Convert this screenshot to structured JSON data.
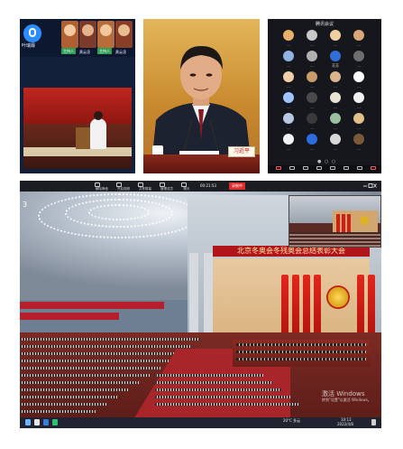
{
  "panel_phone": {
    "user_label": "叶瑞霖",
    "tile_tags": [
      "主持人",
      "主持人"
    ],
    "tile_names": [
      "黄云凌",
      "黄云凌"
    ]
  },
  "panel_closeup": {
    "namecard": "习近平"
  },
  "panel_grid": {
    "title": "腾讯会议",
    "participants": [
      {
        "name": "...",
        "color": "#e8b06a"
      },
      {
        "name": "...",
        "color": "#c9c9c9"
      },
      {
        "name": "...",
        "color": "#f0d0a0"
      },
      {
        "name": "...",
        "color": "#d8a878"
      },
      {
        "name": "...",
        "color": "#8fb4e0"
      },
      {
        "name": "...",
        "color": "#b0b0b0"
      },
      {
        "name": "芳芳",
        "color": "#2f6fd6"
      },
      {
        "name": "...",
        "color": "#6e6e6e"
      },
      {
        "name": "...",
        "color": "#f2cfa8"
      },
      {
        "name": "...",
        "color": "#c99a6a"
      },
      {
        "name": "...",
        "color": "#d9b48e"
      },
      {
        "name": "...",
        "color": "#ffffff"
      },
      {
        "name": "...",
        "color": "#a0c4ff"
      },
      {
        "name": "...",
        "color": "#4a4a4a"
      },
      {
        "name": "...",
        "color": "#e9e3d6"
      },
      {
        "name": "...",
        "color": "#f0f0f0"
      },
      {
        "name": "...",
        "color": "#b7c9e2"
      },
      {
        "name": "...",
        "color": "#3a3a3a"
      },
      {
        "name": "...",
        "color": "#9ac0a0"
      },
      {
        "name": "...",
        "color": "#e2c08a"
      },
      {
        "name": "...",
        "color": "#f3f3f3"
      },
      {
        "name": "...",
        "color": "#2b6ce0"
      },
      {
        "name": "...",
        "color": "#d8d8d8"
      },
      {
        "name": "...",
        "color": "#7a5a3a"
      }
    ]
  },
  "panel_desktop": {
    "banner": "北京冬奥会冬残奥会总结表彰大会",
    "recording": "录制中",
    "timer": "00:21:53",
    "toolbar": [
      "解除静音",
      "开启视频",
      "共享屏幕",
      "管理成员",
      "聊天",
      "录制"
    ],
    "side_number": "3",
    "watermark_line1": "激活 Windows",
    "watermark_line2": "转到\"设置\"以激活 Windows。",
    "weather": "20°C 多云",
    "time": "10:13",
    "date": "2022/4/8"
  }
}
